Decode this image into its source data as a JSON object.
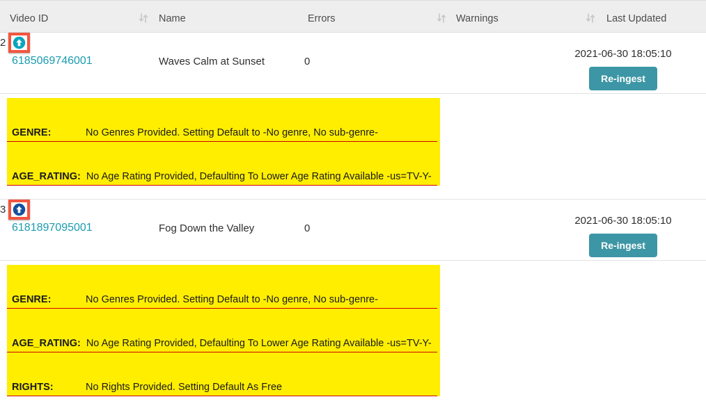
{
  "table": {
    "columns": [
      {
        "key": "video_id",
        "label": "Video ID",
        "sortable": false,
        "sort_icon": ""
      },
      {
        "key": "name",
        "label": "Name",
        "sortable": true,
        "sort_icon": "sort-icon"
      },
      {
        "key": "errors",
        "label": "Errors",
        "sortable": false,
        "sort_icon": ""
      },
      {
        "key": "warnings",
        "label": "Warnings",
        "sortable": true,
        "sort_icon": "sort-icon"
      },
      {
        "key": "last_updated",
        "label": "Last Updated",
        "sortable": true,
        "sort_icon": "sort-icon"
      }
    ],
    "rows": [
      {
        "video_id": "6185069746001",
        "name": "Waves Calm at Sunset",
        "errors": "0",
        "warnings": "2",
        "last_updated": "2021-06-30 18:05:10",
        "action_label": "Re-ingest",
        "warnings_icon": "upload-circle-icon",
        "warnings_icon_state": "teal",
        "details": [
          {
            "label": "GENRE:",
            "message": "No Genres Provided. Setting Default to -No genre, No sub-genre-"
          },
          {
            "label": "AGE_RATING:",
            "message": "No Age Rating Provided, Defaulting To Lower Age Rating Available -us=TV-Y-"
          }
        ]
      },
      {
        "video_id": "6181897095001",
        "name": "Fog Down the Valley",
        "errors": "0",
        "warnings": "3",
        "last_updated": "2021-06-30 18:05:10",
        "action_label": "Re-ingest",
        "warnings_icon": "upload-circle-icon",
        "warnings_icon_state": "navy",
        "details": [
          {
            "label": "GENRE:",
            "message": "No Genres Provided. Setting Default to -No genre, No sub-genre-"
          },
          {
            "label": "AGE_RATING:",
            "message": "No Age Rating Provided, Defaulting To Lower Age Rating Available -us=TV-Y-"
          },
          {
            "label": "RIGHTS:",
            "message": "No Rights Provided. Setting Default As Free"
          }
        ]
      }
    ]
  },
  "colors": {
    "header_bg": "#eeeeee",
    "link": "#1a9cb0",
    "button_bg": "#3d96a5",
    "warning_panel_bg": "#ffee00",
    "warning_divider": "#cc0000",
    "highlight_box": "#f4553f",
    "icon_teal": "#09a4bd",
    "icon_navy": "#13519e"
  }
}
